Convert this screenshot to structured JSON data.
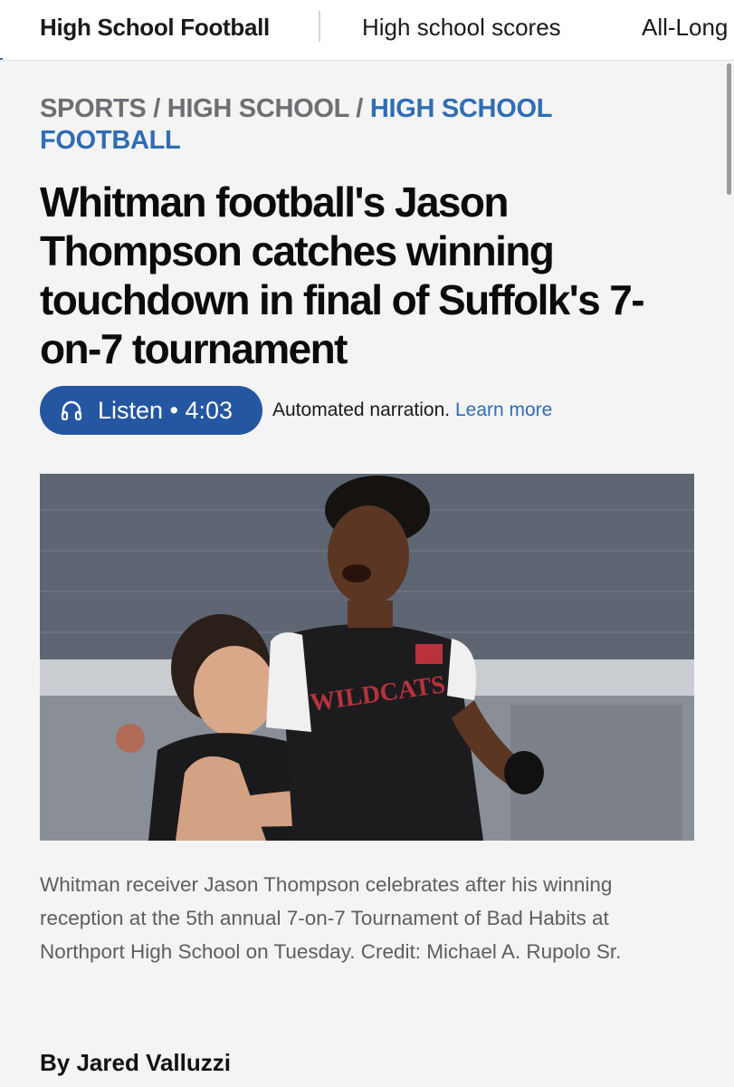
{
  "nav": {
    "items": [
      {
        "label": "High School Football"
      },
      {
        "label": "High school scores"
      },
      {
        "label": "All-Long"
      }
    ]
  },
  "breadcrumb": {
    "part1": "SPORTS",
    "sep": " / ",
    "part2": "HIGH SCHOOL",
    "part3": "HIGH SCHOOL FOOTBALL"
  },
  "article": {
    "headline": "Whitman football's Jason Thompson catches winning touchdown in final of Suffolk's 7-on-7 tournament",
    "listen": {
      "label": "Listen • 4:03",
      "icon": "headphones-icon"
    },
    "narration_text": "Automated narration.",
    "learn_more": "Learn more",
    "photo": {
      "jersey_text": "WILDCATS"
    },
    "caption": "Whitman receiver Jason Thompson celebrates after his winning reception at the 5th annual 7-on-7 Tournament of Bad Habits at Northport High School on Tuesday. Credit: Michael A. Rupolo Sr.",
    "byline": "By Jared Valluzzi"
  },
  "colors": {
    "accent": "#2f6db5",
    "listen_button": "#2456a2",
    "breadcrumb_gray": "#6e6e73",
    "background": "#f4f4f5"
  }
}
